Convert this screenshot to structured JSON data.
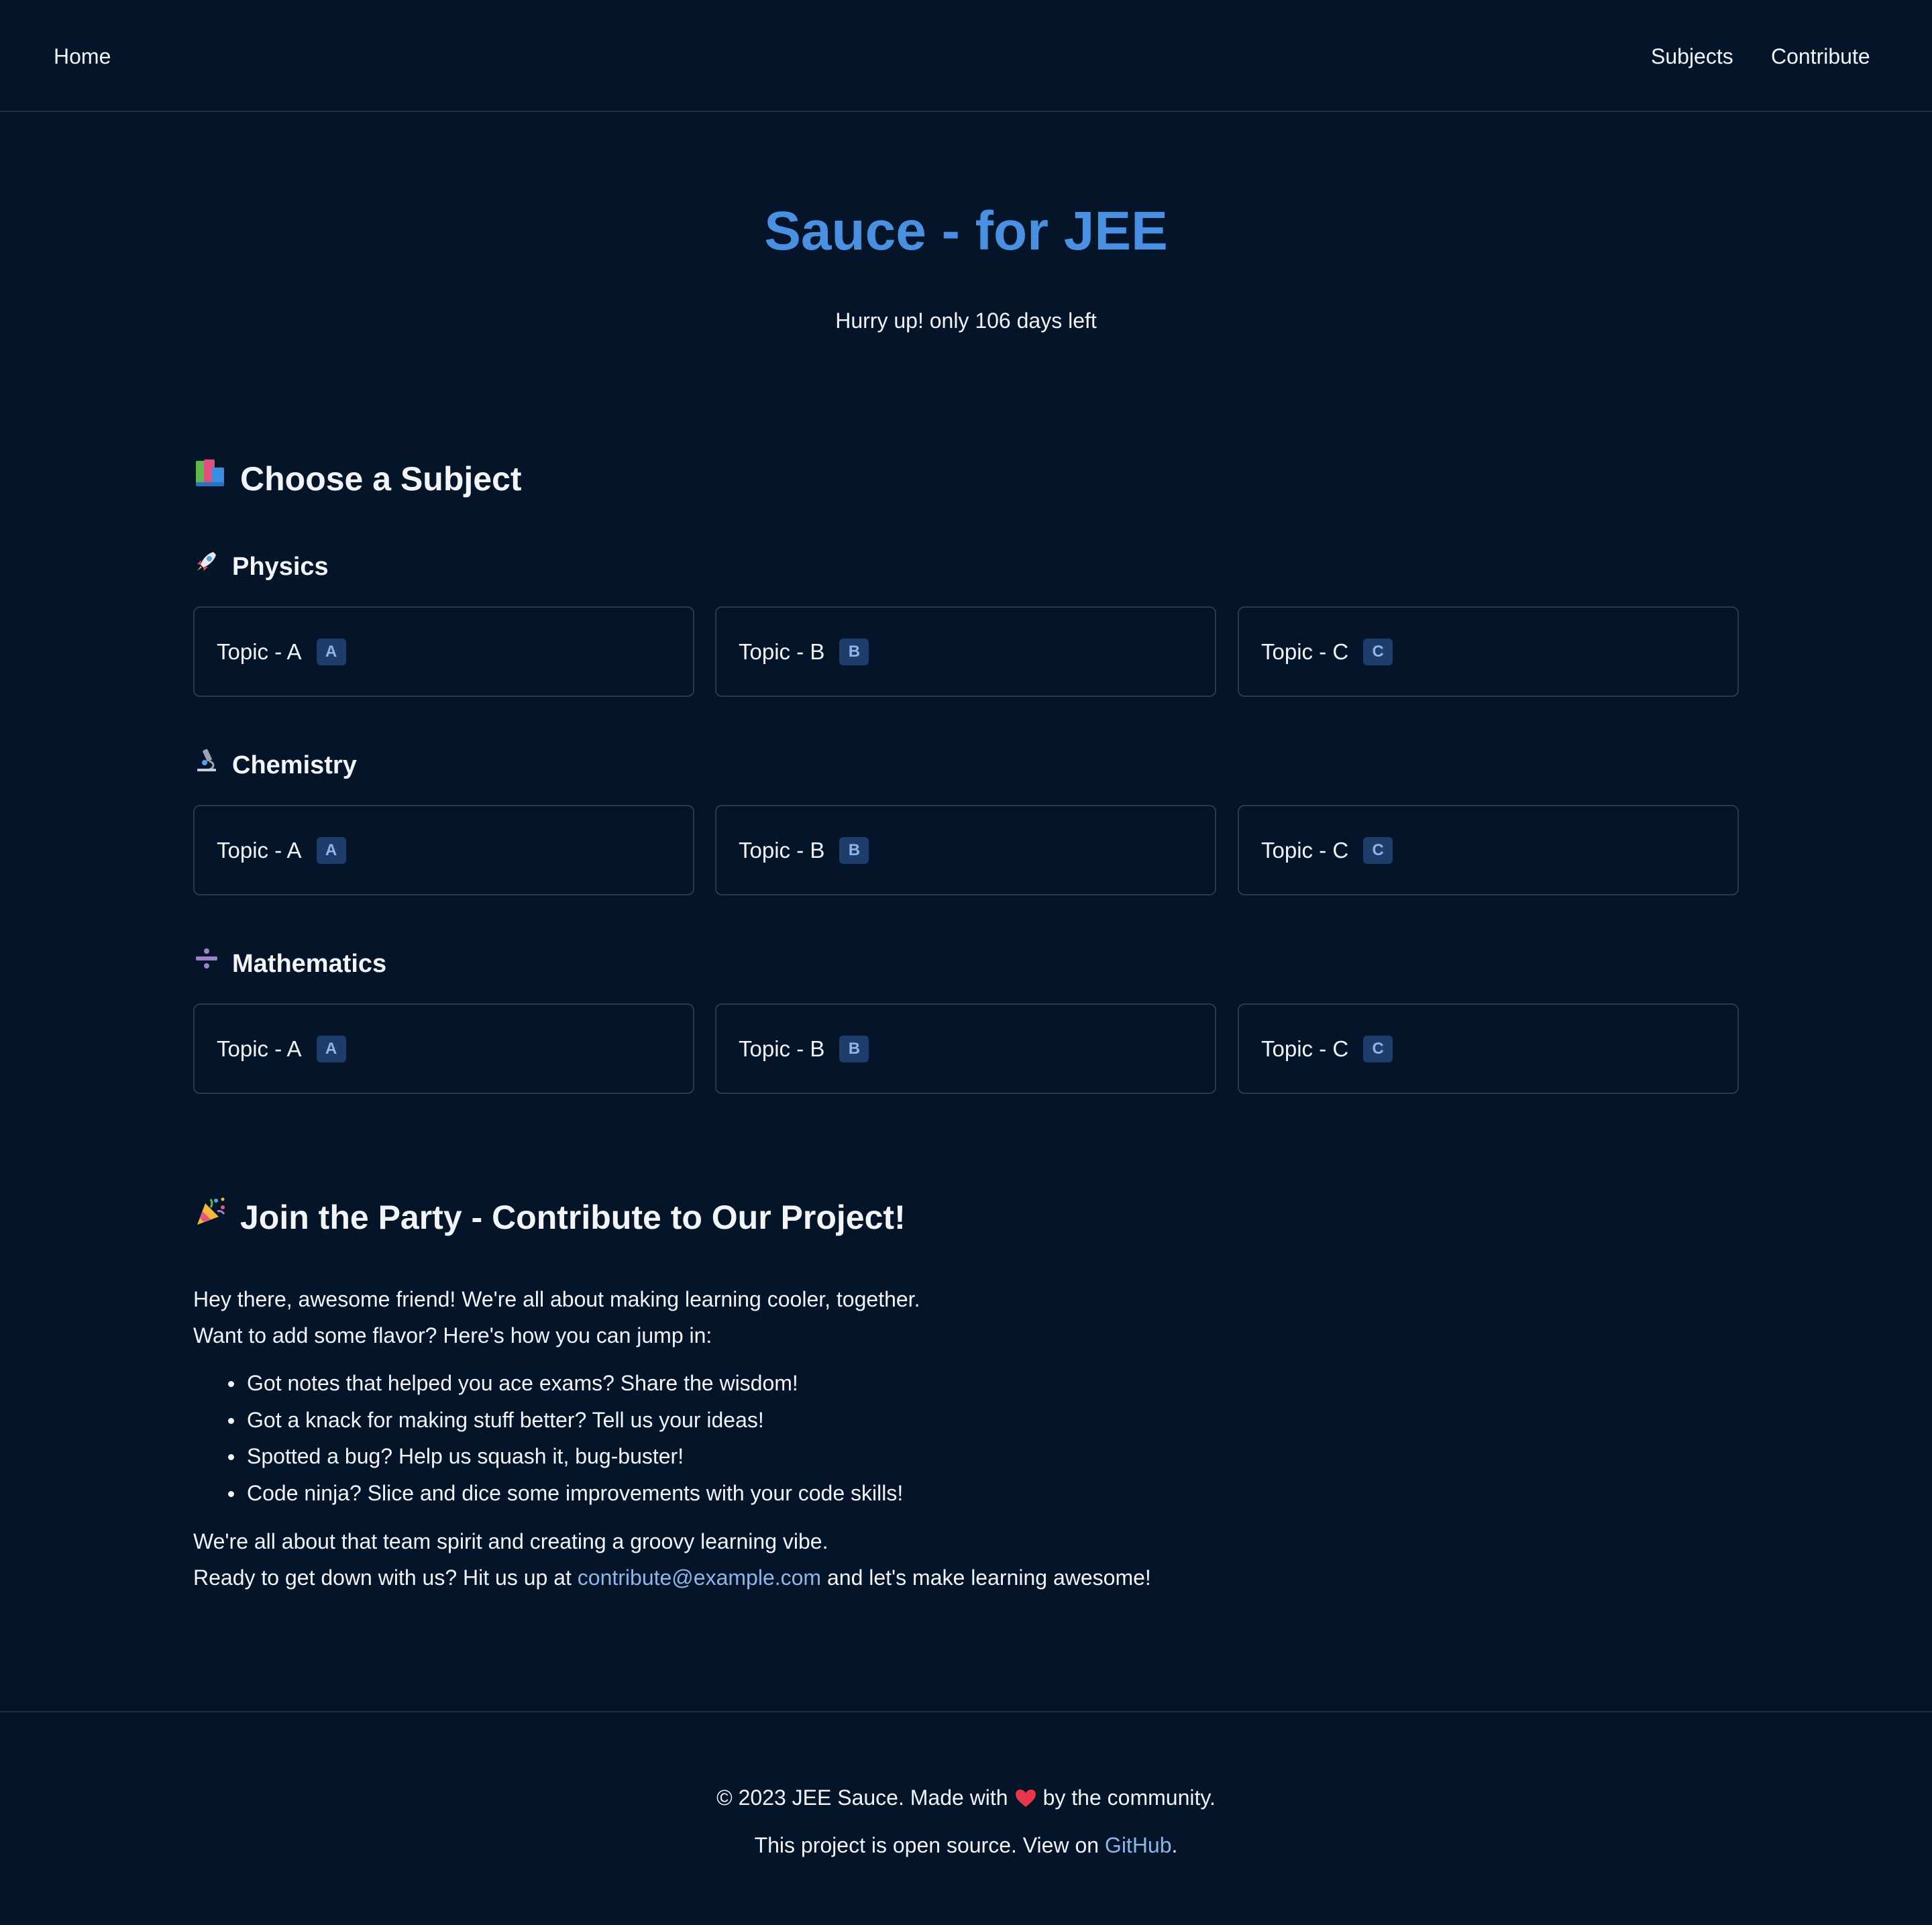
{
  "nav": {
    "home": "Home",
    "subjects": "Subjects",
    "contribute": "Contribute"
  },
  "hero": {
    "title": "Sauce - for JEE",
    "subtitle": "Hurry up! only 106 days left"
  },
  "subjects_section": {
    "heading": "Choose a Subject",
    "icon": "books-icon",
    "subjects": [
      {
        "name": "Physics",
        "icon": "rocket-icon",
        "topics": [
          {
            "label": "Topic - A",
            "badge": "A"
          },
          {
            "label": "Topic - B",
            "badge": "B"
          },
          {
            "label": "Topic - C",
            "badge": "C"
          }
        ]
      },
      {
        "name": "Chemistry",
        "icon": "microscope-icon",
        "topics": [
          {
            "label": "Topic - A",
            "badge": "A"
          },
          {
            "label": "Topic - B",
            "badge": "B"
          },
          {
            "label": "Topic - C",
            "badge": "C"
          }
        ]
      },
      {
        "name": "Mathematics",
        "icon": "divide-icon",
        "topics": [
          {
            "label": "Topic - A",
            "badge": "A"
          },
          {
            "label": "Topic - B",
            "badge": "B"
          },
          {
            "label": "Topic - C",
            "badge": "C"
          }
        ]
      }
    ]
  },
  "contribute_section": {
    "heading": "Join the Party - Contribute to Our Project!",
    "icon": "party-popper-icon",
    "intro_1": "Hey there, awesome friend! We're all about making learning cooler, together.",
    "intro_2": "Want to add some flavor? Here's how you can jump in:",
    "bullets": [
      "Got notes that helped you ace exams? Share the wisdom!",
      "Got a knack for making stuff better? Tell us your ideas!",
      "Spotted a bug? Help us squash it, bug-buster!",
      "Code ninja? Slice and dice some improvements with your code skills!"
    ],
    "outro_1": "We're all about that team spirit and creating a groovy learning vibe.",
    "outro_2_before": "Ready to get down with us? Hit us up at ",
    "email": "contribute@example.com",
    "outro_2_after": " and let's make learning awesome!"
  },
  "footer": {
    "line1_before": "© 2023 JEE Sauce. Made with",
    "line1_after": "by the community.",
    "heart_icon": "heart-icon",
    "line2_before": "This project is open source. View on ",
    "github": "GitHub",
    "line2_after": "."
  },
  "colors": {
    "background": "#04152a",
    "accent": "#4a90e2",
    "link": "#8fb6ea",
    "badge_bg": "#1e3d6b",
    "card_border": "#2a3a4e"
  }
}
